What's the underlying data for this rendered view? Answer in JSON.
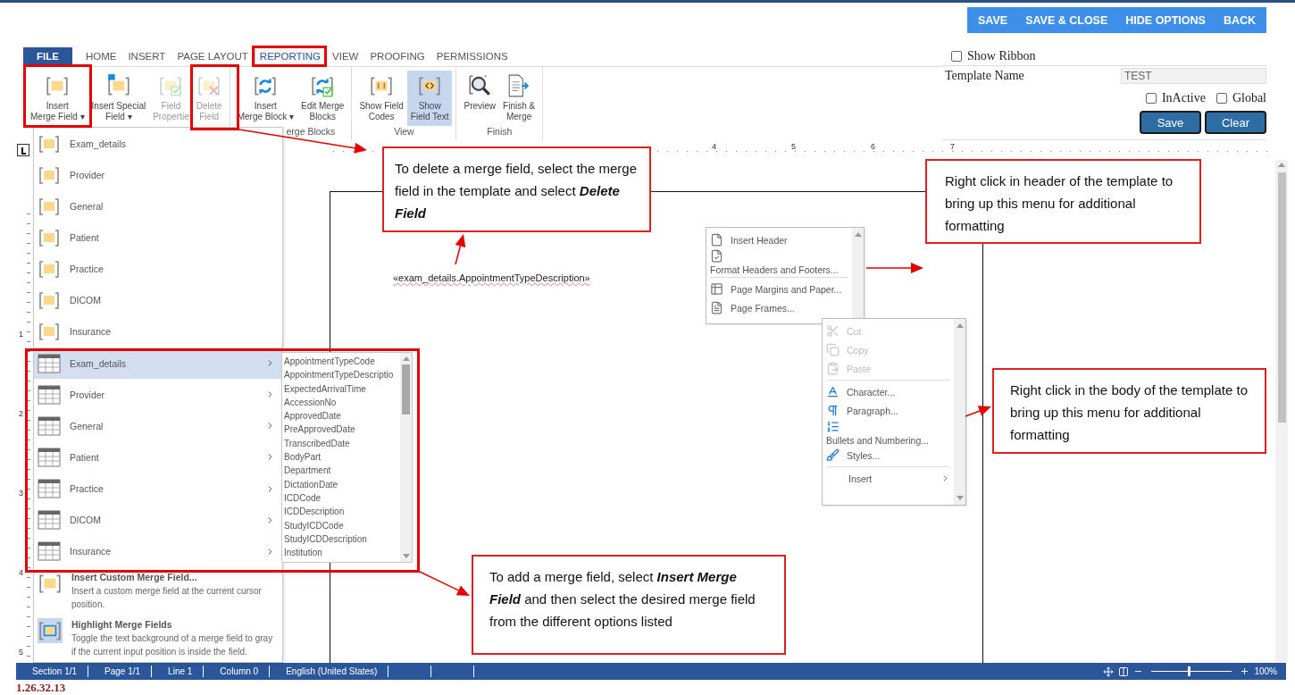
{
  "action_bar": {
    "buttons": [
      "SAVE",
      "SAVE & CLOSE",
      "HIDE OPTIONS",
      "BACK"
    ]
  },
  "tabs": [
    {
      "label": "FILE",
      "kind": "file",
      "selected": false
    },
    {
      "label": "HOME",
      "kind": "tab",
      "selected": false
    },
    {
      "label": "INSERT",
      "kind": "tab",
      "selected": false
    },
    {
      "label": "PAGE LAYOUT",
      "kind": "tab",
      "selected": false
    },
    {
      "label": "REPORTING",
      "kind": "tab",
      "selected": true
    },
    {
      "label": "VIEW",
      "kind": "tab",
      "selected": false
    },
    {
      "label": "PROOFING",
      "kind": "tab",
      "selected": false
    },
    {
      "label": "PERMISSIONS",
      "kind": "tab",
      "selected": false
    }
  ],
  "ribbon": {
    "groups": [
      {
        "buttons": [
          {
            "lines": [
              "Insert",
              "Merge Field ▾"
            ],
            "disabled": false,
            "selected": false
          },
          {
            "lines": [
              "Insert Special",
              "Field ▾"
            ],
            "disabled": false,
            "selected": false
          },
          {
            "lines": [
              "Field",
              "Propertie"
            ],
            "disabled": true,
            "selected": false
          },
          {
            "lines": [
              "Delete",
              "Field"
            ],
            "disabled": true,
            "selected": false
          }
        ]
      },
      {
        "label": "erge Blocks",
        "buttons": [
          {
            "lines": [
              "Insert",
              "Merge Block ▾"
            ],
            "disabled": false,
            "selected": false
          },
          {
            "lines": [
              "Edit Merge",
              "Blocks"
            ],
            "disabled": false,
            "selected": false
          }
        ]
      },
      {
        "label": "View",
        "buttons": [
          {
            "lines": [
              "Show Field",
              "Codes"
            ],
            "disabled": false,
            "selected": false
          },
          {
            "lines": [
              "Show",
              "Field Text"
            ],
            "disabled": false,
            "selected": true
          }
        ]
      },
      {
        "label": "Finish",
        "buttons": [
          {
            "lines": [
              "Preview"
            ],
            "disabled": false,
            "selected": false
          },
          {
            "lines": [
              "Finish &",
              "Merge"
            ],
            "disabled": false,
            "selected": false
          }
        ]
      }
    ]
  },
  "options": {
    "show_ribbon": {
      "label": "Show Ribbon",
      "checked": false
    },
    "template_name": {
      "label": "Template Name",
      "value": "TEST"
    },
    "flags": [
      {
        "label": "InActive",
        "checked": false
      },
      {
        "label": "Global",
        "checked": false
      }
    ],
    "buttons": [
      "Save",
      "Clear"
    ]
  },
  "rulers": {
    "horizontal": [
      "4",
      "5",
      "6",
      "7"
    ],
    "vertical": [
      "1",
      "2",
      "3",
      "4",
      "5"
    ]
  },
  "document": {
    "merge_field": "«exam_details.AppointmentTypeDescription»"
  },
  "merge_field_menu": {
    "field_groups": [
      "Exam_details",
      "Provider",
      "General",
      "Patient",
      "Practice",
      "DICOM",
      "Insurance"
    ],
    "tables": [
      {
        "label": "Exam_details",
        "selected": true
      },
      {
        "label": "Provider",
        "selected": false
      },
      {
        "label": "General",
        "selected": false
      },
      {
        "label": "Patient",
        "selected": false
      },
      {
        "label": "Practice",
        "selected": false
      },
      {
        "label": "DICOM",
        "selected": false
      },
      {
        "label": "Insurance",
        "selected": false
      }
    ],
    "commands": [
      {
        "title": "Insert Custom Merge Field...",
        "description": "Insert a custom merge field at the current cursor position.",
        "on": false
      },
      {
        "title": "Highlight Merge Fields",
        "description": "Toggle the text background of a merge field to gray if the current input position is inside the field.",
        "on": true
      }
    ]
  },
  "field_submenu": {
    "items": [
      "AppointmentTypeCode",
      "AppointmentTypeDescriptio",
      "ExpectedArrivalTime",
      "AccessionNo",
      "ApprovedDate",
      "PreApprovedDate",
      "TranscribedDate",
      "BodyPart",
      "Department",
      "DictationDate",
      "ICDCode",
      "ICDDescription",
      "StudyICDCode",
      "StudyICDDescription",
      "Institution"
    ]
  },
  "header_context_menu": {
    "items": [
      {
        "kind": "item",
        "label": "Insert Header"
      },
      {
        "kind": "stacked",
        "label": "Format Headers and Footers..."
      },
      {
        "kind": "separator"
      },
      {
        "kind": "item",
        "label": "Page Margins and Paper..."
      },
      {
        "kind": "item",
        "label": "Page Frames..."
      }
    ]
  },
  "body_context_menu": {
    "items": [
      {
        "kind": "item",
        "label": "Cut",
        "disabled": true
      },
      {
        "kind": "item",
        "label": "Copy",
        "disabled": true
      },
      {
        "kind": "item",
        "label": "Paste",
        "disabled": true
      },
      {
        "kind": "separator"
      },
      {
        "kind": "item",
        "label": "Character...",
        "disabled": false
      },
      {
        "kind": "item",
        "label": "Paragraph...",
        "disabled": false
      },
      {
        "kind": "stacked",
        "label": "Bullets and Numbering...",
        "disabled": false
      },
      {
        "kind": "item",
        "label": "Styles...",
        "disabled": false
      },
      {
        "kind": "separator"
      },
      {
        "kind": "submenu",
        "label": "Insert",
        "disabled": false
      }
    ]
  },
  "callouts": [
    "To delete a merge field, select the merge field in the template and select **Delete Field**",
    "Right click in header of the template to bring up this menu for additional formatting",
    "Right click in the body of the template to bring up this menu for additional formatting",
    "To add a merge field, select **Insert Merge Field** and then select the desired merge field from the different options listed"
  ],
  "status_bar": {
    "items": [
      "Section 1/1",
      "Page 1/1",
      "Line 1",
      "Column 0",
      "English (United States)"
    ],
    "zoom": {
      "level": 0.45,
      "reading": "100%"
    }
  },
  "version": "1.26.32.13"
}
